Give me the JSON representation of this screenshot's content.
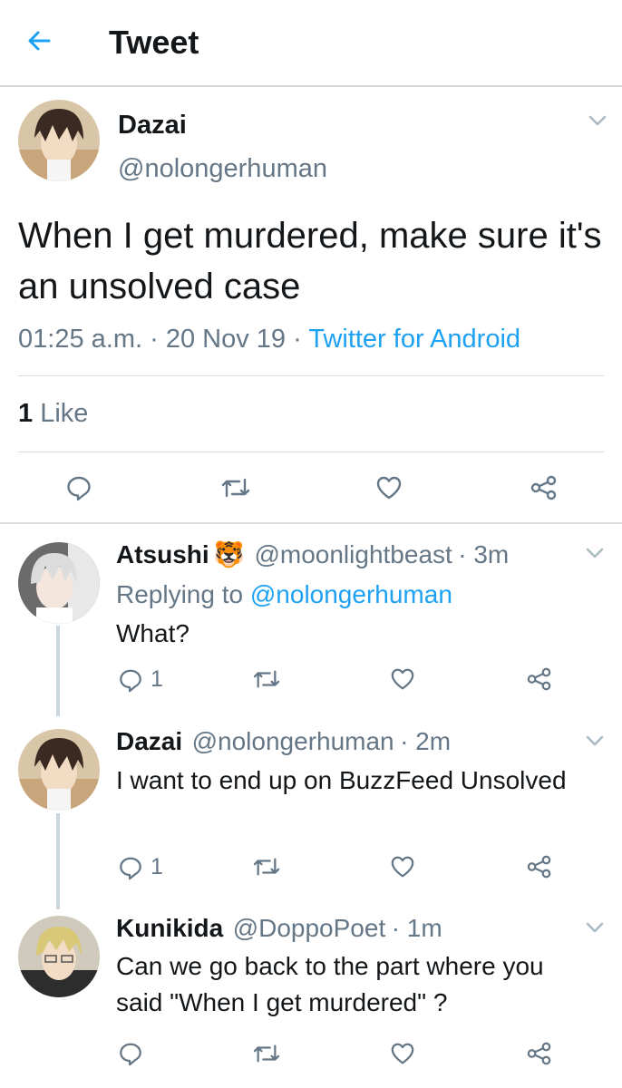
{
  "header": {
    "title": "Tweet",
    "back_icon": "arrow-left-icon"
  },
  "tweet": {
    "name": "Dazai",
    "handle": "@nolongerhuman",
    "text": "When I get murdered, make sure it's an unsolved case",
    "time": "01:25 a.m.",
    "date": "20 Nov 19",
    "sep": "·",
    "source": "Twitter for Android",
    "likes_count": "1",
    "likes_label": "Like"
  },
  "replies": [
    {
      "name": "Atsushi",
      "emoji": "🐯",
      "handle": "@moonlightbeast",
      "time": "· 3m",
      "replying_prefix": "Replying to",
      "replying_handle": "@nolongerhuman",
      "text": "What?",
      "reply_count": "1"
    },
    {
      "name": "Dazai",
      "handle": "@nolongerhuman",
      "time": "· 2m",
      "text": "I want to end up on BuzzFeed Unsolved",
      "reply_count": "1"
    },
    {
      "name": "Kunikida",
      "handle": "@DoppoPoet",
      "time": "· 1m",
      "text_line1": "Can we go back to the part where you",
      "text_line2": "said \"When I get murdered\" ?"
    }
  ],
  "colors": {
    "link": "#1da1f2",
    "secondary": "#657786",
    "divider": "#d8dde2"
  }
}
